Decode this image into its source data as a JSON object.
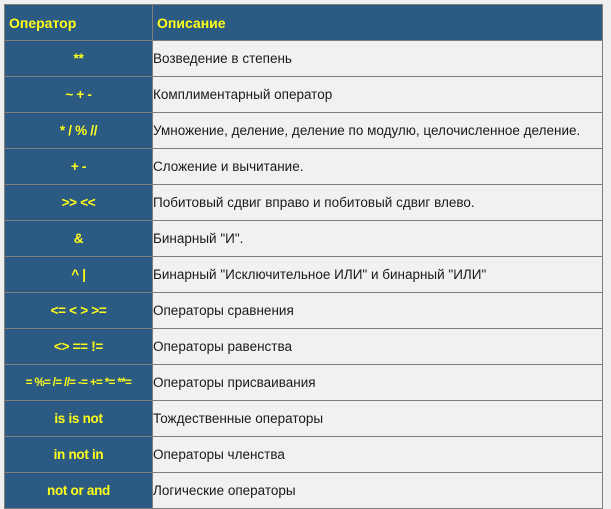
{
  "table": {
    "headers": {
      "operator": "Оператор",
      "description": "Описание"
    },
    "rows": [
      {
        "operator": "**",
        "description": "Возведение в степень"
      },
      {
        "operator": "~ + -",
        "description": "Комплиментарный оператор"
      },
      {
        "operator": "* / % //",
        "description": "Умножение, деление, деление по модулю, целочисленное деление."
      },
      {
        "operator": "+ -",
        "description": "Сложение и вычитание."
      },
      {
        "operator": ">> <<",
        "description": "Побитовый сдвиг вправо и побитовый сдвиг влево."
      },
      {
        "operator": "&",
        "description": "Бинарный \"И\"."
      },
      {
        "operator": "^ |",
        "description": "Бинарный  \"Исключительное ИЛИ\" и бинарный \"ИЛИ\""
      },
      {
        "operator": "<= < > >=",
        "description": "Операторы сравнения"
      },
      {
        "operator": "<> == !=",
        "description": "Операторы равенства"
      },
      {
        "operator": "= %= /= //= -= += *= **=",
        "description": "Операторы присваивания"
      },
      {
        "operator": "is is not",
        "description": "Тождественные операторы"
      },
      {
        "operator": "in not in",
        "description": "Операторы членства"
      },
      {
        "operator": "not or and",
        "description": "Логические операторы"
      }
    ]
  },
  "colors": {
    "header_bg": "#2b5a82",
    "operator_text": "#ffff1a",
    "description_bg": "#f1f1f1"
  }
}
